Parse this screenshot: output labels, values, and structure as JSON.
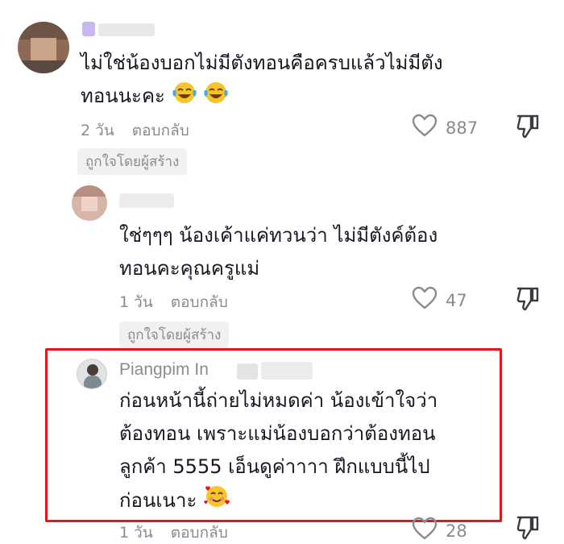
{
  "comments": [
    {
      "text_lines": [
        "ไม่ใช่น้องบอกไม่มีตังทอนคือครบแล้วไม่มีตัง",
        "ทอนนะคะ"
      ],
      "time": "2 วัน",
      "reply_label": "ตอบกลับ",
      "likes": "887",
      "badge": "ถูกใจโดยผู้สร้าง",
      "emoji_after_text": [
        "face-with-tears-of-joy",
        "face-with-tears-of-joy"
      ]
    },
    {
      "text_lines": [
        "ใช่ๆๆๆ น้องเค้าแค่ทวนว่า ไม่มีตังค์ต้อง",
        "ทอนคะคุณครูแม่"
      ],
      "time": "1 วัน",
      "reply_label": "ตอบกลับ",
      "likes": "47",
      "badge": "ถูกใจโดยผู้สร้าง"
    },
    {
      "author": "Piangpim In",
      "text_lines": [
        "ก่อนหน้านี้ถ่ายไม่หมดค่า น้องเข้าใจว่า",
        "ต้องทอน เพราะแม่น้องบอกว่าต้องทอน",
        "ลูกค้า 5555 เอ็นดูค่าาาา ฝึกแบบนี้ไป",
        "ก่อนเนาะ"
      ],
      "time": "1 วัน",
      "reply_label": "ตอบกลับ",
      "likes": "28",
      "emoji_after_text": [
        "smiling-face-with-hearts"
      ]
    }
  ],
  "colors": {
    "highlight_border": "#e8141b",
    "muted_text": "#8a8b91",
    "badge_bg": "#f1f1f2"
  },
  "icons": [
    "heart-outline-icon",
    "thumbs-down-icon"
  ]
}
